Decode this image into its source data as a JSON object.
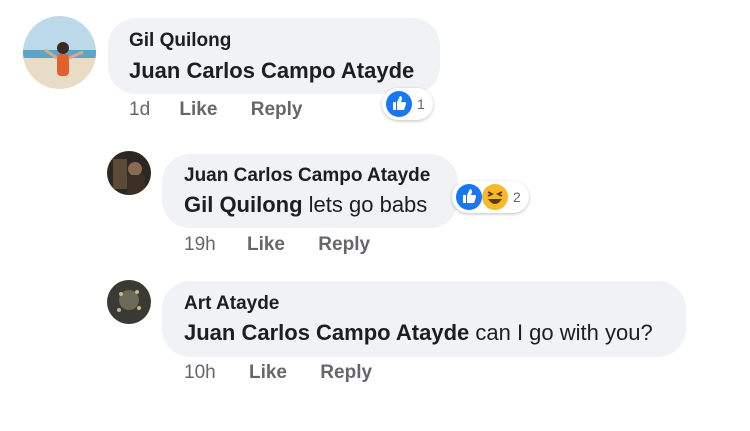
{
  "comments": [
    {
      "author": "Gil Quilong",
      "mention": "Juan Carlos Campo Atayde",
      "text": "",
      "time": "1d",
      "like_label": "Like",
      "reply_label": "Reply",
      "reactions": {
        "icons": [
          "like-icon"
        ],
        "count": "1"
      }
    },
    {
      "author": "Juan Carlos Campo Atayde",
      "mention": "Gil Quilong",
      "text": " lets go babs",
      "time": "19h",
      "like_label": "Like",
      "reply_label": "Reply",
      "reactions": {
        "icons": [
          "like-icon",
          "haha-icon"
        ],
        "count": "2"
      }
    },
    {
      "author": "Art Atayde",
      "mention": "Juan Carlos Campo Atayde",
      "text": " can I go with you?",
      "time": "10h",
      "like_label": "Like",
      "reply_label": "Reply"
    }
  ],
  "colors": {
    "bubble": "#f0f2f5",
    "meta_text": "#65676b",
    "like_blue": "#1877f2",
    "haha_yellow": "#f7b928"
  }
}
